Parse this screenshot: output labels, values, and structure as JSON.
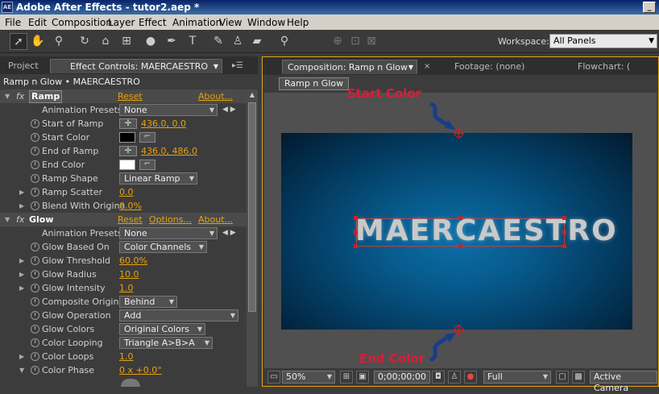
{
  "window": {
    "app_icon": "AE",
    "title": "Adobe After Effects - tutor2.aep *",
    "minimize": "_"
  },
  "menu": [
    "File",
    "Edit",
    "Composition",
    "Layer",
    "Effect",
    "Animation",
    "View",
    "Window",
    "Help"
  ],
  "toolbar": {
    "tools": [
      "selection-tool",
      "hand-tool",
      "zoom-tool",
      "rotation-tool",
      "camera-orbit-tool",
      "pan-behind-tool",
      "ellipse-tool",
      "pen-tool",
      "type-tool",
      "brush-tool",
      "clone-stamp-tool",
      "eraser-tool",
      "puppet-pin-tool"
    ],
    "workspace_label": "Workspace:",
    "workspace_value": "All Panels"
  },
  "left_panel": {
    "tabs": [
      "Project",
      "Effect Controls: MAERCAESTRO"
    ],
    "header": "Ramp n Glow • MAERCAESTRO",
    "effects": [
      {
        "name": "Ramp",
        "reset": "Reset",
        "about": "About...",
        "params": [
          {
            "label": "Animation Presets:",
            "type": "dropdown",
            "value": "None",
            "arrows": "◀ ▶"
          },
          {
            "label": "Start of Ramp",
            "type": "point",
            "value": "436.0, 0.0"
          },
          {
            "label": "Start Color",
            "type": "color",
            "value": "#000000"
          },
          {
            "label": "End of Ramp",
            "type": "point",
            "value": "436.0, 486.0"
          },
          {
            "label": "End Color",
            "type": "color",
            "value": "#ffffff"
          },
          {
            "label": "Ramp Shape",
            "type": "dropdown",
            "value": "Linear Ramp"
          },
          {
            "label": "Ramp Scatter",
            "type": "value",
            "value": "0.0",
            "expand": true
          },
          {
            "label": "Blend With Origina",
            "type": "value",
            "value": "0.0%",
            "expand": true
          }
        ]
      },
      {
        "name": "Glow",
        "reset": "Reset",
        "options": "Options...",
        "about": "About...",
        "params": [
          {
            "label": "Animation Presets:",
            "type": "dropdown",
            "value": "None",
            "arrows": "◀ ▶"
          },
          {
            "label": "Glow Based On",
            "type": "dropdown",
            "value": "Color Channels"
          },
          {
            "label": "Glow Threshold",
            "type": "value",
            "value": "60.0%",
            "expand": true
          },
          {
            "label": "Glow Radius",
            "type": "value",
            "value": "10.0",
            "expand": true
          },
          {
            "label": "Glow Intensity",
            "type": "value",
            "value": "1.0",
            "expand": true
          },
          {
            "label": "Composite Original",
            "type": "dropdown",
            "value": "Behind"
          },
          {
            "label": "Glow Operation",
            "type": "dropdown",
            "value": "Add"
          },
          {
            "label": "Glow Colors",
            "type": "dropdown",
            "value": "Original Colors"
          },
          {
            "label": "Color Looping",
            "type": "dropdown",
            "value": "Triangle A>B>A"
          },
          {
            "label": "Color Loops",
            "type": "value",
            "value": "1.0",
            "expand": true
          },
          {
            "label": "Color Phase",
            "type": "value",
            "value": "0 x +0.0°",
            "expand": true,
            "expanded": true
          }
        ]
      }
    ]
  },
  "right_panel": {
    "tabs": [
      "Composition: Ramp n Glow",
      "Footage: (none)",
      "Flowchart: ("
    ],
    "comp_button": "Ramp n Glow",
    "layer_text": "MAERCAESTRO",
    "annotations": {
      "start": "Start Color",
      "end": "End Color"
    },
    "viewer_bar": {
      "zoom": "50%",
      "timecode": "0;00;00;00",
      "resolution": "Full",
      "camera": "Active Camera"
    }
  },
  "colors": {
    "accent": "#e8a20e",
    "annotation": "#e0193a"
  }
}
